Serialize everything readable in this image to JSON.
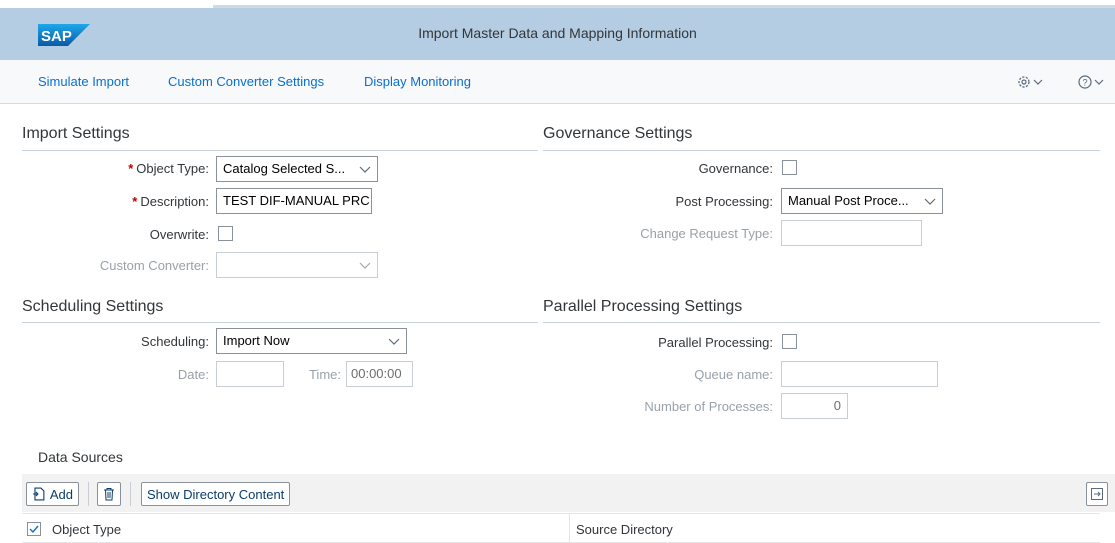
{
  "shell": {
    "logo_text": "SAP",
    "title": "Import Master Data and Mapping Information"
  },
  "toolbar": {
    "links": [
      "Simulate Import",
      "Custom Converter Settings",
      "Display Monitoring"
    ],
    "settings_icon": "gear-icon",
    "help_icon": "help-icon"
  },
  "import_settings": {
    "title": "Import Settings",
    "object_type_label": "Object Type:",
    "object_type_value": "Catalog Selected S...",
    "description_label": "Description:",
    "description_value": "TEST DIF-MANUAL PRC",
    "overwrite_label": "Overwrite:",
    "custom_converter_label": "Custom Converter:",
    "custom_converter_value": ""
  },
  "governance_settings": {
    "title": "Governance Settings",
    "governance_label": "Governance:",
    "post_processing_label": "Post Processing:",
    "post_processing_value": "Manual Post Proce...",
    "change_request_type_label": "Change Request Type:",
    "change_request_type_value": ""
  },
  "scheduling_settings": {
    "title": "Scheduling Settings",
    "scheduling_label": "Scheduling:",
    "scheduling_value": "Import Now",
    "date_label": "Date:",
    "date_value": "",
    "time_label": "Time:",
    "time_value": "00:00:00"
  },
  "parallel_settings": {
    "title": "Parallel Processing Settings",
    "parallel_label": "Parallel Processing:",
    "queue_name_label": "Queue name:",
    "queue_name_value": "",
    "num_processes_label": "Number of Processes:",
    "num_processes_value": "0"
  },
  "data_sources": {
    "title": "Data Sources",
    "add_label": "Add",
    "show_directory_label": "Show Directory Content",
    "columns": [
      "Object Type",
      "Source Directory"
    ]
  },
  "colors": {
    "shellbar": "#b4cde2",
    "link": "#0a6ed1",
    "required": "#bb0000"
  }
}
